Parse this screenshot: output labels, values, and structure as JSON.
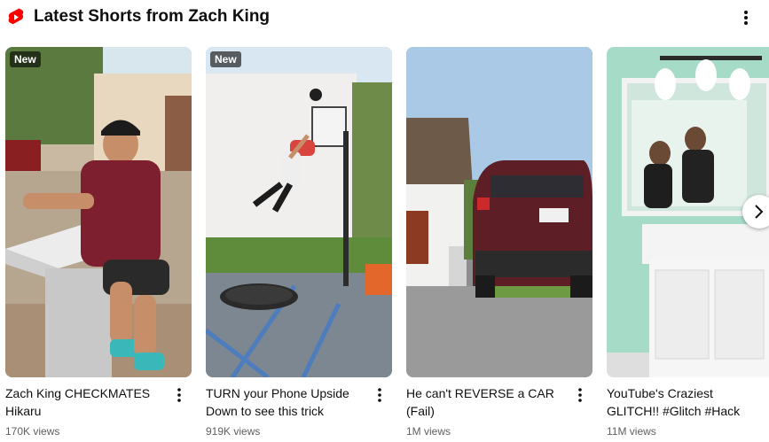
{
  "section": {
    "title": "Latest Shorts from Zach King",
    "icon": "youtube-shorts-icon",
    "accent_color": "#ff0000",
    "menu_icon": "more-vert-icon"
  },
  "shorts": [
    {
      "badge": "New",
      "title": "Zach King CHECKMATES Hikaru",
      "views": "170K views"
    },
    {
      "badge": "New",
      "title": "TURN your Phone Upside Down to see this trick",
      "views": "919K views"
    },
    {
      "badge": "",
      "title": "He can't REVERSE a CAR (Fail)",
      "views": "1M views"
    },
    {
      "badge": "",
      "title": "YouTube's Craziest GLITCH!! #Glitch #Hack",
      "views": "11M views"
    }
  ],
  "carousel": {
    "next_icon": "chevron-right-icon"
  }
}
